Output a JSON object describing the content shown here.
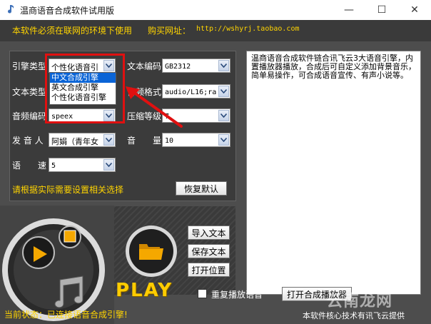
{
  "window": {
    "title": "温商语音合成软件试用版",
    "minimize_glyph": "—",
    "maximize_glyph": "☐",
    "close_glyph": "✕"
  },
  "topbar": {
    "notice": "本软件必须在联网的环境下使用",
    "buy_label": "购买网址：",
    "buy_url": "http://wshyrj.taobao.com"
  },
  "form": {
    "engine_label": "引擎类型",
    "engine_value": "个性化语音引",
    "text_encoding_label": "文本编码",
    "text_encoding_value": "GB2312",
    "text_type_label": "文本类型",
    "audio_format_label": "音频格式",
    "audio_format_value": "audio/L16;ra",
    "audio_encoding_label": "音频编码",
    "audio_encoding_value": "speex",
    "compression_label": "压缩等级",
    "compression_value": "7",
    "speaker_label": "发 音 人",
    "speaker_value": "阿娟（青年女",
    "volume_label": "音　　量",
    "volume_value": "10",
    "speed_label": "语　　速",
    "speed_value": "5"
  },
  "engine_dropdown": {
    "options": [
      "中文合成引擎",
      "英文合成引擎",
      "个性化语音引擎"
    ],
    "selected_index": 0
  },
  "hint": "请根据实际需要设置相关选择",
  "buttons": {
    "reset": "恢复默认",
    "import_text": "导入文本",
    "save_text": "保存文本",
    "open_location": "打开位置",
    "open_player": "打开合成播放器"
  },
  "textarea": {
    "content": "温商语音合成软件链合讯飞云3大语音引擎，内置播放器播放，合成后可自定义添加背景音乐，简单易操作，可合成语音宣传、有声小说等。"
  },
  "play_text": "PLAY",
  "repeat_checkbox": {
    "label": "重复播放语音",
    "checked": false
  },
  "status": "当前状态：已连接语音合成引擎!",
  "credits": "本软件核心技术有讯飞云提供",
  "watermark": "云南龙网",
  "colors": {
    "accent_yellow": "#ffd400",
    "highlight_red": "#e01010",
    "selection_blue": "#0a64d6",
    "background": "#4d4d4d"
  },
  "icons": [
    "app-note-icon",
    "play-icon",
    "stop-icon",
    "music-notes-icon",
    "folder-icon",
    "chevron-down-icon"
  ]
}
